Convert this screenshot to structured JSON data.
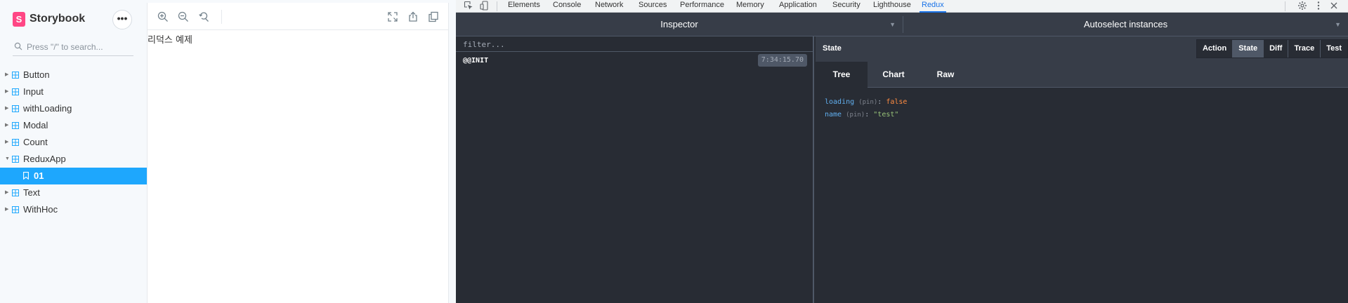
{
  "storybook": {
    "title": "Storybook",
    "logo_letter": "S",
    "menu_glyph": "•••",
    "search_placeholder": "Press \"/\" to search...",
    "tree": [
      {
        "label": "Button"
      },
      {
        "label": "Input"
      },
      {
        "label": "withLoading"
      },
      {
        "label": "Modal"
      },
      {
        "label": "Count"
      },
      {
        "label": "ReduxApp",
        "expanded": true
      },
      {
        "label": "01",
        "selected": true
      },
      {
        "label": "Text"
      },
      {
        "label": "WithHoc"
      }
    ]
  },
  "preview": {
    "content_text": "리덕스 예제"
  },
  "devtools": {
    "tabs": [
      "Elements",
      "Console",
      "Network",
      "Sources",
      "Performance",
      "Memory",
      "Application",
      "Security",
      "Lighthouse",
      "Redux"
    ],
    "active_tab": "Redux"
  },
  "redux": {
    "inspector_label": "Inspector",
    "instances_label": "Autoselect instances",
    "filter_placeholder": "filter...",
    "actions": [
      {
        "name": "@@INIT",
        "time": "7:34:15.70"
      }
    ],
    "state_title": "State",
    "monitor_buttons": [
      "Action",
      "State",
      "Diff",
      "Trace",
      "Test"
    ],
    "active_monitor": "State",
    "subtabs": [
      "Tree",
      "Chart",
      "Raw"
    ],
    "active_subtab": "Tree",
    "state": {
      "row1": {
        "key": "loading",
        "pin": "(pin)",
        "colon": ":",
        "value": "false"
      },
      "row2": {
        "key": "name",
        "pin": "(pin)",
        "colon": ":",
        "value": "\"test\""
      }
    }
  },
  "colors": {
    "storybook_accent": "#ff4785",
    "selected_story": "#1ea7fd",
    "redux_bg": "#282c34",
    "devtools_active_tab": "#1a73e8"
  }
}
